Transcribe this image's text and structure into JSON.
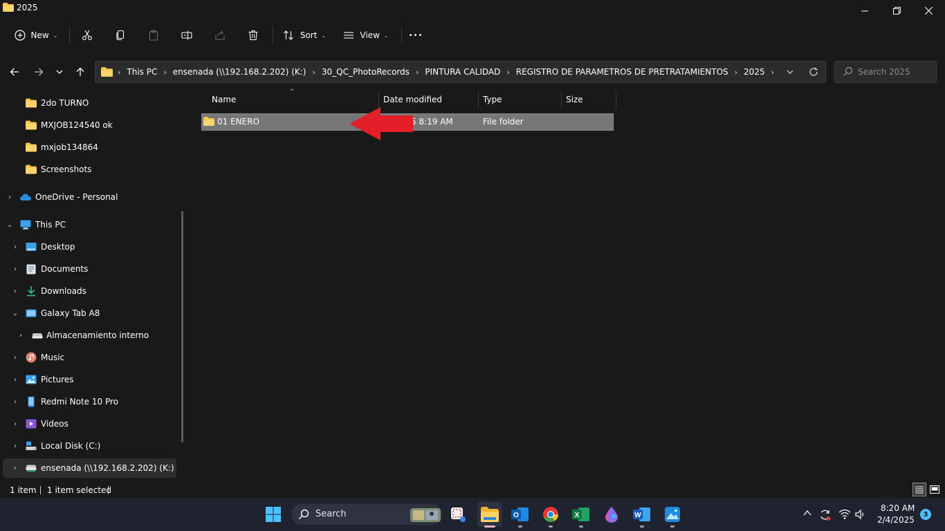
{
  "window": {
    "title": "2025",
    "controls": {
      "minimize": "—",
      "maximize": "⧉",
      "close": "✕"
    }
  },
  "toolbar": {
    "new_label": "New",
    "sort_label": "Sort",
    "view_label": "View",
    "more_label": "•••"
  },
  "address": {
    "crumbs": [
      "This PC",
      "ensenada (\\\\192.168.2.202) (K:)",
      "30_QC_PhotoRecords",
      "PINTURA CALIDAD",
      "REGISTRO DE PARAMETROS DE PRETRATAMIENTOS",
      "2025"
    ],
    "search_placeholder": "Search 2025"
  },
  "nav_pane": {
    "items": [
      {
        "label": "2do TURNO",
        "icon": "folder-icon"
      },
      {
        "label": "MXJOB124540 ok",
        "icon": "folder-icon"
      },
      {
        "label": "mxjob134864",
        "icon": "folder-icon"
      },
      {
        "label": "Screenshots",
        "icon": "folder-icon"
      },
      {
        "label": "OneDrive - Personal",
        "icon": "cloud-icon"
      },
      {
        "label": "This PC",
        "icon": "computer-icon"
      },
      {
        "label": "Desktop",
        "icon": "desktop-icon"
      },
      {
        "label": "Documents",
        "icon": "documents-icon"
      },
      {
        "label": "Downloads",
        "icon": "download-icon"
      },
      {
        "label": "Galaxy Tab A8",
        "icon": "tablet-icon"
      },
      {
        "label": "Almacenamiento interno",
        "icon": "drive-icon"
      },
      {
        "label": "Music",
        "icon": "music-icon"
      },
      {
        "label": "Pictures",
        "icon": "pictures-icon"
      },
      {
        "label": "Redmi Note 10 Pro",
        "icon": "phone-icon"
      },
      {
        "label": "Videos",
        "icon": "videos-icon"
      },
      {
        "label": "Local Disk (C:)",
        "icon": "local-disk-icon"
      },
      {
        "label": "ensenada (\\\\192.168.2.202) (K:)",
        "icon": "network-drive-icon"
      }
    ]
  },
  "file_list": {
    "columns": [
      "Name",
      "Date modified",
      "Type",
      "Size"
    ],
    "rows": [
      {
        "name": "01 ENERO",
        "date_modified": "5 8:19 AM",
        "type": "File folder",
        "size": ""
      }
    ]
  },
  "status": {
    "item_count": "1 item",
    "selected": "1 item selected"
  },
  "taskbar": {
    "search_label": "Search",
    "apps": [
      "windows-start",
      "snipping-tool",
      "file-explorer",
      "outlook",
      "chrome",
      "excel",
      "paint",
      "word",
      "photos"
    ],
    "tray_badge": "3",
    "time": "8:20 AM",
    "date": "2/4/2025"
  },
  "colors": {
    "selection_row": "#777777",
    "annotation_arrow": "#e3202a",
    "folder_yellow": "#f7c548"
  }
}
